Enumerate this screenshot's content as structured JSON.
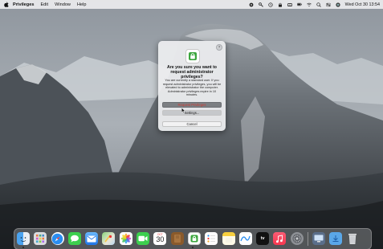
{
  "menubar": {
    "app_name": "Privileges",
    "menus": [
      "Edit",
      "Window",
      "Help"
    ],
    "clock": "Wed Oct 30  13:54"
  },
  "dialog": {
    "help_label": "?",
    "title": "Are you sure you want to request administrator privileges?",
    "message": "You are currently a standard user. If you request administrator privileges, you will be elevated to administrator the computer. Administrator privileges expire in 10 minutes.",
    "buttons": {
      "request": "Request Privileges",
      "settings": "Settings...",
      "cancel": "Cancel"
    },
    "colors": {
      "accent_red": "#d03b33",
      "lock_green": "#3aa53c"
    }
  },
  "dock": {
    "calendar": {
      "month": "OCT",
      "day": "30"
    },
    "tv_label": "tv",
    "apps": [
      "finder",
      "launchpad",
      "safari",
      "messages",
      "mail",
      "maps",
      "photos",
      "facetime",
      "calendar",
      "notes-brown",
      "privileges",
      "reminders",
      "notes",
      "freeform",
      "tv",
      "music",
      "system-settings",
      "screen-sharing",
      "downloads",
      "trash"
    ]
  }
}
